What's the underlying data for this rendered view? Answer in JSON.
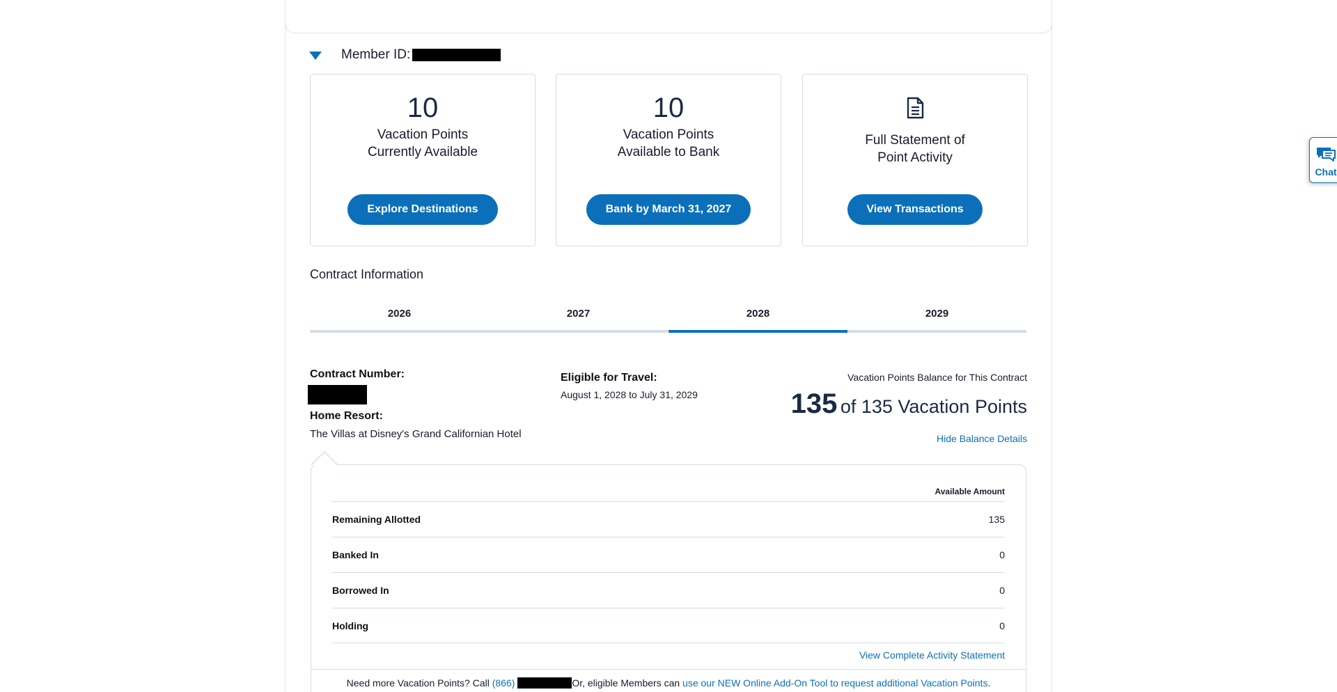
{
  "member": {
    "label": "Member ID:"
  },
  "cards": [
    {
      "number": "10",
      "line1": "Vacation Points",
      "line2": "Currently Available",
      "button": "Explore Destinations"
    },
    {
      "number": "10",
      "line1": "Vacation Points",
      "line2": "Available to Bank",
      "button": "Bank by March 31, 2027"
    },
    {
      "icon": "document-icon",
      "line1": "Full Statement of",
      "line2": "Point Activity",
      "button": "View Transactions"
    }
  ],
  "contract": {
    "section_title": "Contract Information",
    "tabs": [
      "2026",
      "2027",
      "2028",
      "2029"
    ],
    "active_tab": "2028",
    "number_label": "Contract Number:",
    "home_resort_label": "Home Resort:",
    "home_resort": "The Villas at Disney's Grand Californian Hotel",
    "eligible_label": "Eligible for Travel:",
    "eligible_dates": "August 1, 2028 to July 31, 2029",
    "balance_caption": "Vacation Points Balance for This Contract",
    "balance_value": "135",
    "balance_total": "of 135 Vacation Points",
    "hide_link": "Hide Balance Details"
  },
  "details": {
    "header": "Available Amount",
    "rows": [
      {
        "name": "Remaining Allotted",
        "value": "135"
      },
      {
        "name": "Banked In",
        "value": "0"
      },
      {
        "name": "Borrowed In",
        "value": "0"
      },
      {
        "name": "Holding",
        "value": "0"
      }
    ],
    "complete_link": "View Complete Activity Statement"
  },
  "footer": {
    "text1": "Need more Vacation Points? Call",
    "phone_prefix": "(866)",
    "text2": "Or, eligible Members can",
    "link": "use our NEW Online Add-On Tool to request additional Vacation Points",
    "end": "."
  },
  "chat": {
    "label": "Chat"
  },
  "colors": {
    "brand": "#0b6fba",
    "border": "#d6dde5",
    "text": "#1a1a2e"
  }
}
